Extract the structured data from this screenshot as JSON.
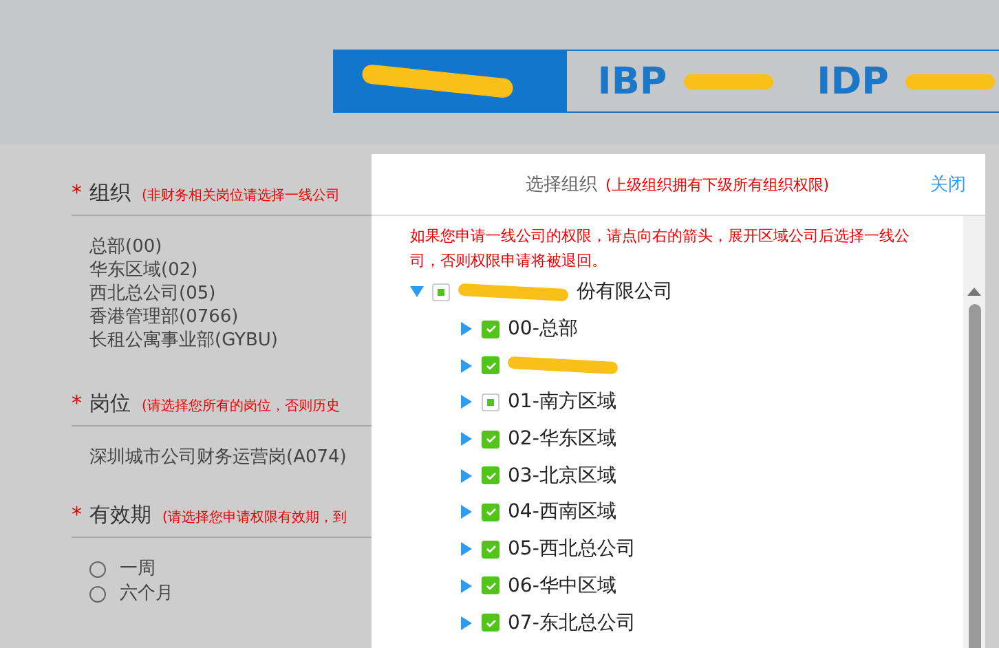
{
  "header_tabs": [
    {
      "kind": "redacted",
      "selected": true
    },
    {
      "kind": "logo",
      "label": "IBP",
      "selected": false
    },
    {
      "kind": "logo",
      "label": "IDP",
      "selected": false
    }
  ],
  "form": {
    "sections": [
      {
        "required_mark": "*",
        "label": "组织",
        "hint": "(非财务相关岗位请选择一线公司",
        "kind": "list",
        "values": [
          "总部(00)",
          "华东区域(02)",
          "西北总公司(05)",
          "香港管理部(0766)",
          "长租公寓事业部(GYBU)"
        ]
      },
      {
        "required_mark": "*",
        "label": "岗位",
        "hint": "(请选择您所有的岗位，否则历史",
        "kind": "list",
        "values": [
          "深圳城市公司财务运营岗(A074)"
        ]
      },
      {
        "required_mark": "*",
        "label": "有效期",
        "hint": "(请选择您申请权限有效期，到",
        "kind": "radio",
        "options": [
          {
            "label": "一周",
            "selected": false
          },
          {
            "label": "六个月",
            "selected": false
          }
        ]
      }
    ]
  },
  "dialog": {
    "title": "选择组织",
    "subtitle": "(上级组织拥有下级所有组织权限)",
    "close": "关闭",
    "notice": "如果您申请一线公司的权限，请点向右的箭头，展开区域公司后选择一线公司，否则权限申请将被退回。",
    "tree": [
      {
        "label": "份有限公司",
        "redacted": true,
        "expanded": true,
        "checked": false,
        "indeterminate": true,
        "children": [
          {
            "label": "00-总部",
            "redacted": false,
            "expanded": false,
            "checked": true,
            "indeterminate": false
          },
          {
            "redacted": true,
            "expanded": false,
            "checked": true,
            "indeterminate": false
          },
          {
            "label": "01-南方区域",
            "redacted": false,
            "expanded": false,
            "checked": false,
            "indeterminate": true
          },
          {
            "label": "02-华东区域",
            "redacted": false,
            "expanded": false,
            "checked": true,
            "indeterminate": false
          },
          {
            "label": "03-北京区域",
            "redacted": false,
            "expanded": false,
            "checked": true,
            "indeterminate": false
          },
          {
            "label": "04-西南区域",
            "redacted": false,
            "expanded": false,
            "checked": true,
            "indeterminate": false
          },
          {
            "label": "05-西北总公司",
            "redacted": false,
            "expanded": false,
            "checked": true,
            "indeterminate": false
          },
          {
            "label": "06-华中区域",
            "redacted": false,
            "expanded": false,
            "checked": true,
            "indeterminate": false
          },
          {
            "label": "07-东北总公司",
            "redacted": false,
            "expanded": false,
            "checked": true,
            "indeterminate": false
          }
        ]
      }
    ]
  }
}
